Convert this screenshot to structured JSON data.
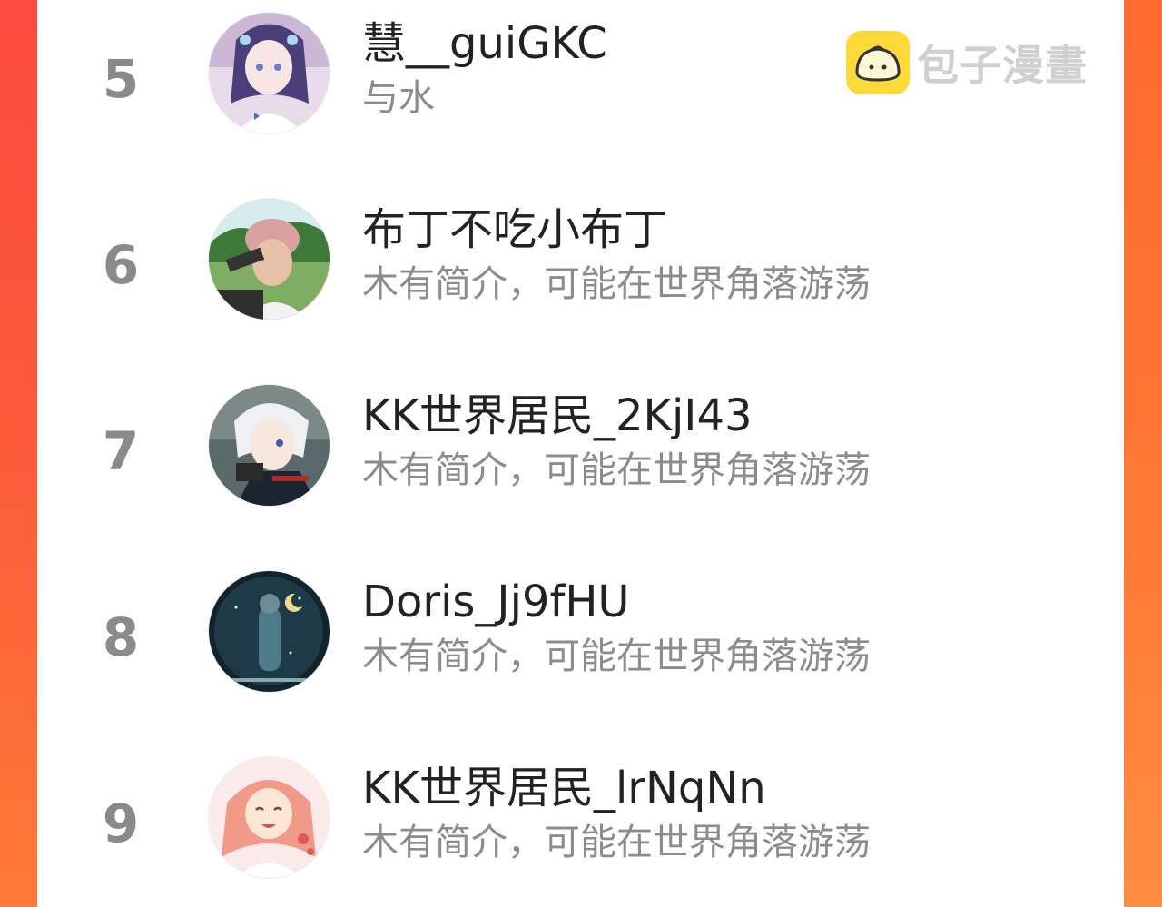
{
  "watermark": {
    "text": "包子漫畫",
    "logo_icon": "bun-face-icon",
    "logo_color": "#ffd83a"
  },
  "colors": {
    "frame_red": "#fb4a3e",
    "frame_orange": "#ff7a38",
    "rank_gray": "#8a8a8a",
    "name_dark": "#222222",
    "bio_gray": "#8c8c8c"
  },
  "leaderboard": {
    "entries": [
      {
        "rank": "5",
        "name": "慧__guiGKC",
        "bio": "与水",
        "avatar_icon": "avatar-anime-girl-icon"
      },
      {
        "rank": "6",
        "name": "布丁不吃小布丁",
        "bio": "木有简介，可能在世界角落游荡",
        "avatar_icon": "avatar-photo-helmet-icon"
      },
      {
        "rank": "7",
        "name": "KK世界居民_2KjI43",
        "bio": "木有简介，可能在世界角落游荡",
        "avatar_icon": "avatar-anime-boy-icon"
      },
      {
        "rank": "8",
        "name": "Doris_Jj9fHU",
        "bio": "木有简介，可能在世界角落游荡",
        "avatar_icon": "avatar-poster-icon"
      },
      {
        "rank": "9",
        "name": "KK世界居民_lrNqNn",
        "bio": "木有简介，可能在世界角落游荡",
        "avatar_icon": "avatar-anime-smile-icon"
      }
    ]
  }
}
